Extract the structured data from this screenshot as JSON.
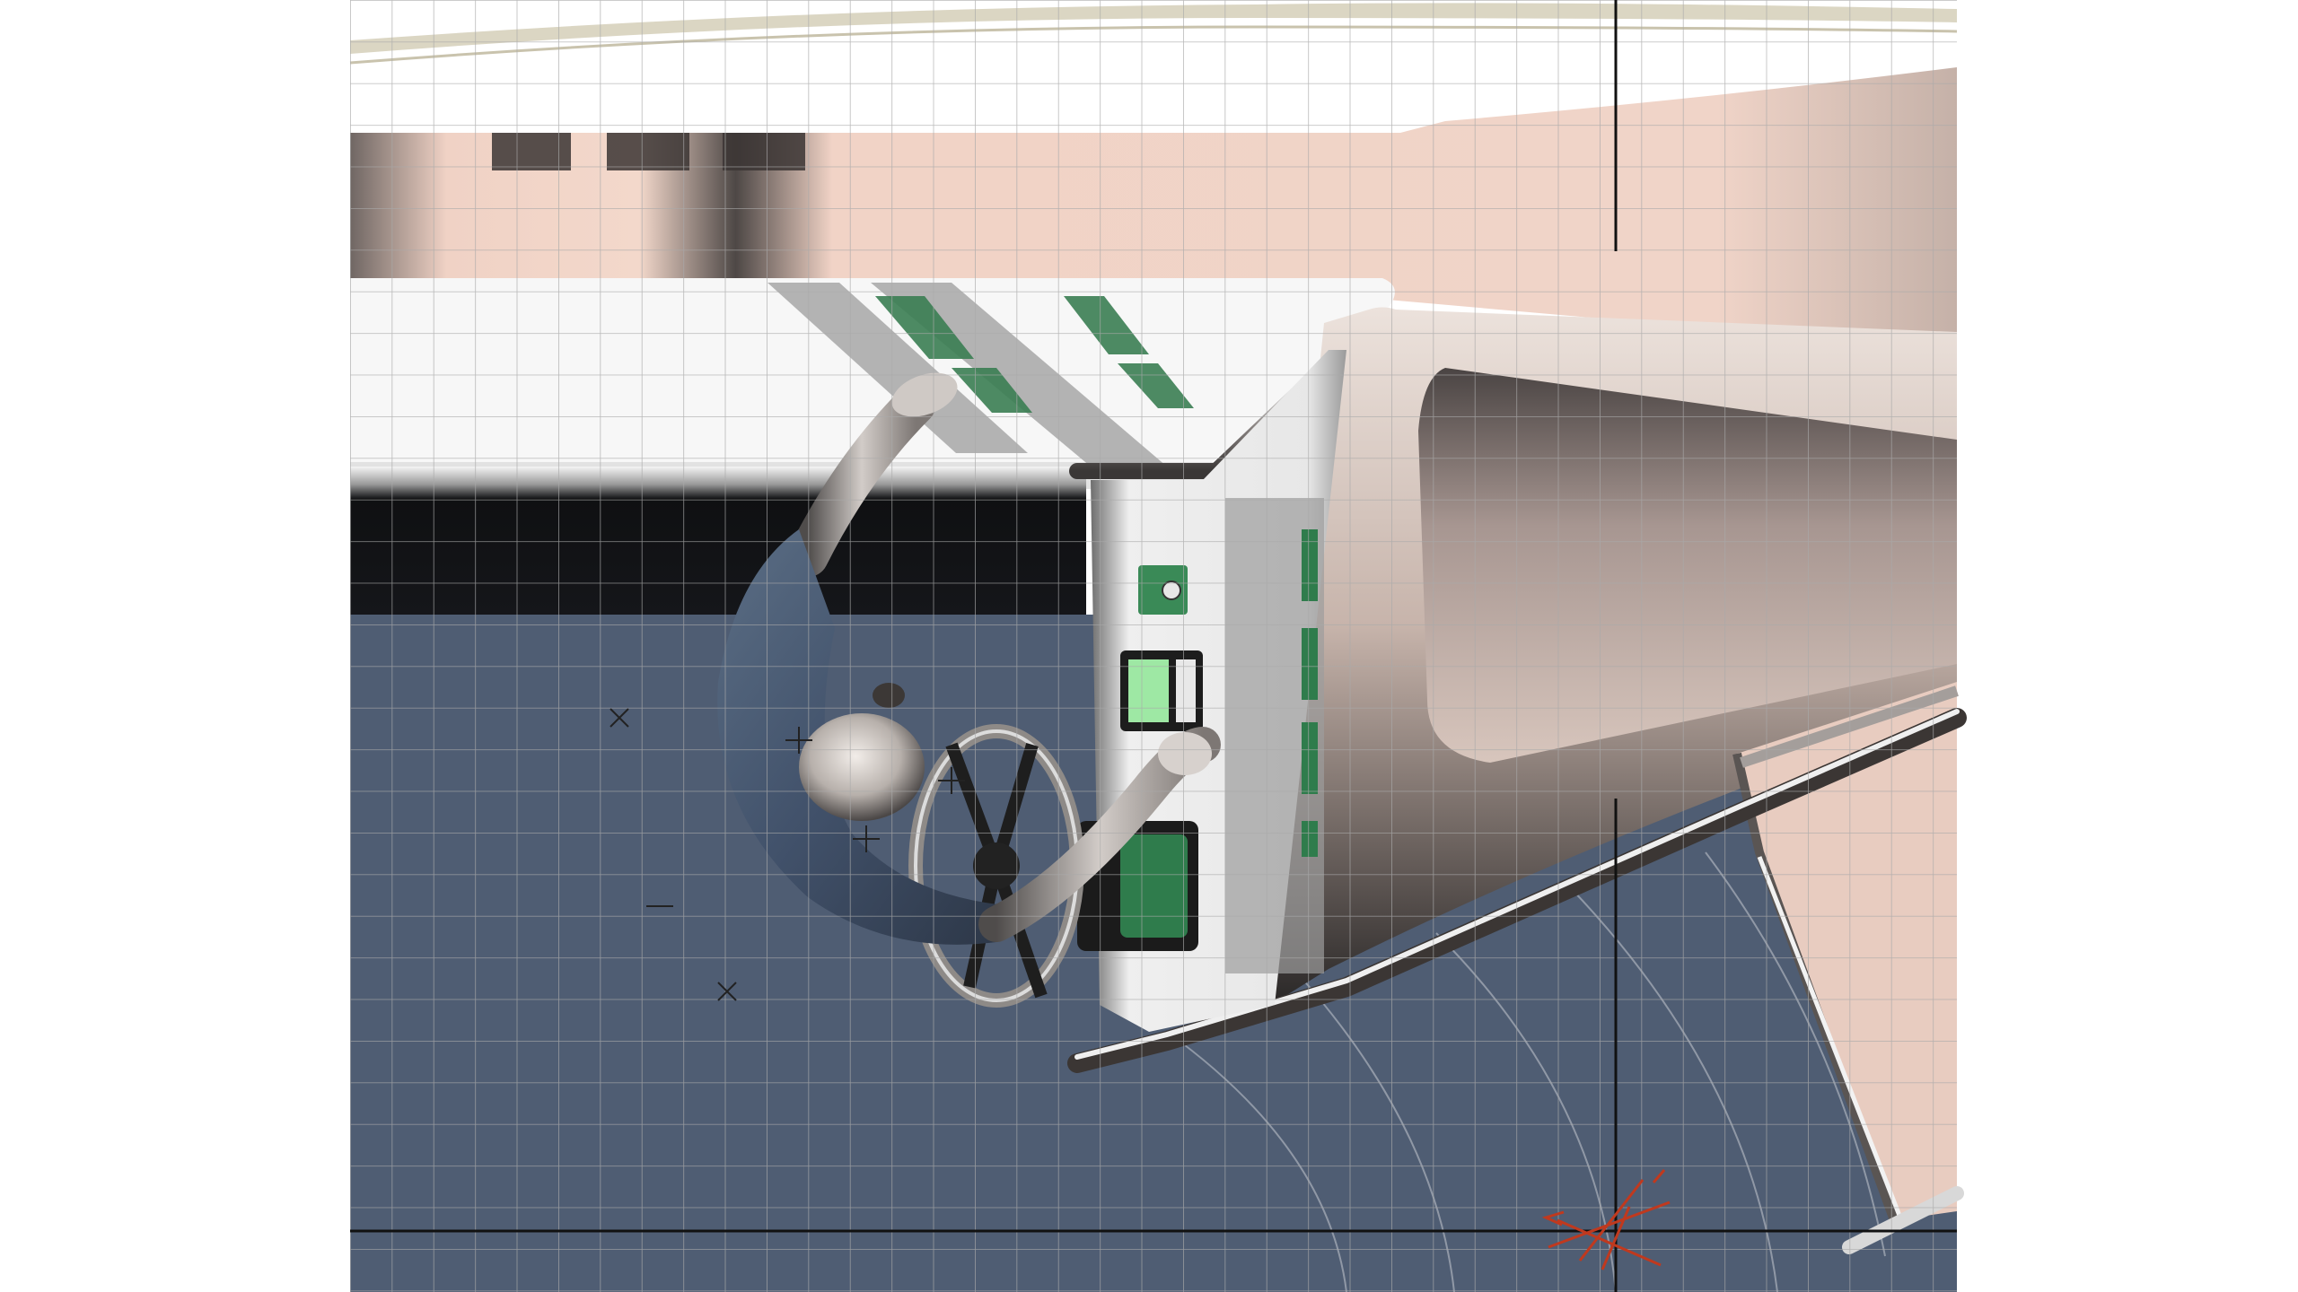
{
  "viewport": {
    "title": "",
    "view_mode": "top",
    "grid_visible": true
  },
  "palette": {
    "floor": "#4e5c72",
    "hull": "#f0d4c7",
    "hull_shadow": "#b9a39a",
    "metal_dark": "#2a2a2a",
    "panel_green": "#2f7c4c",
    "screen_green": "#9ee8a4",
    "stripe_black": "#111214",
    "grid_line": "#a9a9a9",
    "axis_line": "#111111",
    "manipulator_red": "#c0391e"
  },
  "objects": {
    "seated_operator": "human-figure",
    "steering_wheel": "wheel",
    "control_console": "console",
    "front_hull": "hull",
    "transform_gizmo": "manipulator"
  }
}
